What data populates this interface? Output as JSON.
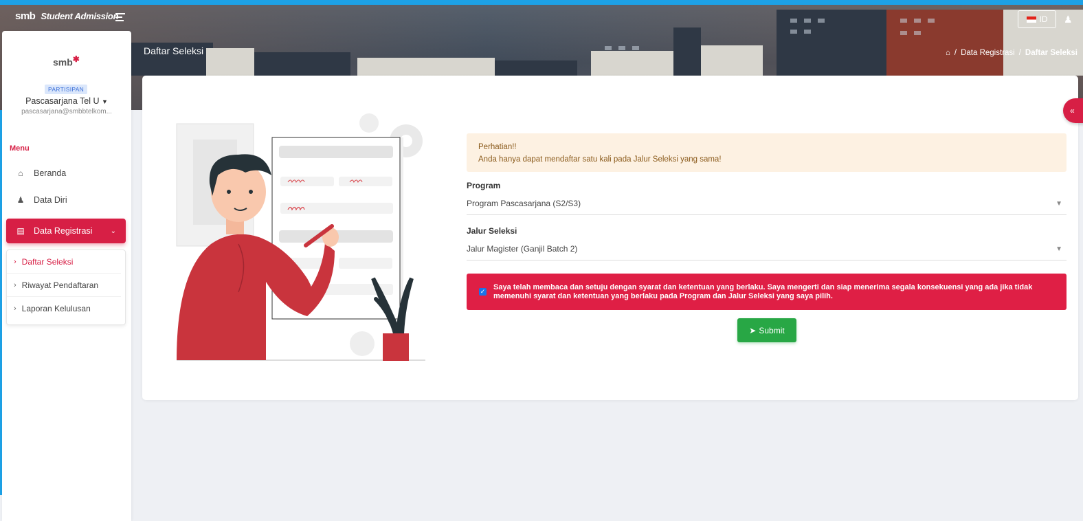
{
  "app": {
    "brand": "smb",
    "name": "Student Admission",
    "language": "ID"
  },
  "header": {
    "page_title": "Daftar Seleksi",
    "breadcrumb": [
      "Data Registrasi",
      "Daftar Seleksi"
    ]
  },
  "sidebar": {
    "logo_text": "smb",
    "role": "PARTISIPAN",
    "user_name": "Pascasarjana Tel U",
    "user_email": "pascasarjana@smbbtelkom...",
    "menu_label": "Menu",
    "items": [
      {
        "label": "Beranda",
        "icon": "home-icon"
      },
      {
        "label": "Data Diri",
        "icon": "user-icon"
      },
      {
        "label": "Data Registrasi",
        "icon": "clipboard-icon",
        "active": true
      }
    ],
    "subitems": [
      {
        "label": "Daftar Seleksi",
        "active": true
      },
      {
        "label": "Riwayat Pendaftaran"
      },
      {
        "label": "Laporan Kelulusan"
      }
    ]
  },
  "form": {
    "alert_title": "Perhatian!!",
    "alert_text": "Anda hanya dapat mendaftar satu kali pada Jalur Seleksi yang sama!",
    "program_label": "Program",
    "program_value": "Program Pascasarjana (S2/S3)",
    "jalur_label": "Jalur Seleksi",
    "jalur_value": "Jalur Magister (Ganjil Batch 2)",
    "agreement_checked": true,
    "agreement_text": "Saya telah membaca dan setuju dengan syarat dan ketentuan yang berlaku. Saya mengerti dan siap menerima segala konsekuensi yang ada jika tidak memenuhi syarat dan ketentuan yang berlaku pada Program dan Jalur Seleksi yang saya pilih.",
    "submit_label": "Submit"
  },
  "colors": {
    "primary": "#d71f45",
    "success": "#28a745",
    "top_strip": "#1da1e6",
    "alert_bg": "#fdf1e2"
  }
}
